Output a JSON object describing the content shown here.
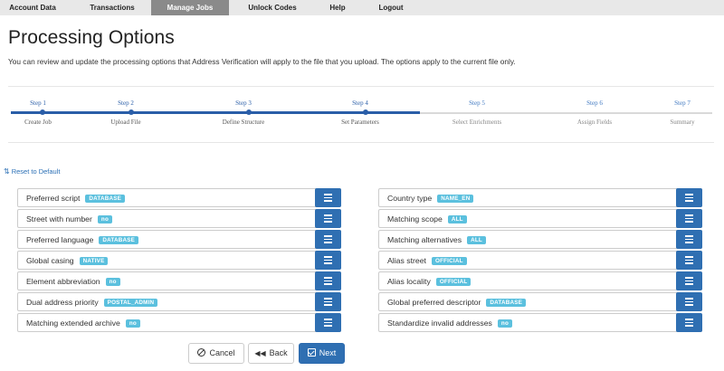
{
  "nav": {
    "items": [
      "Account Data",
      "Transactions",
      "Manage Jobs",
      "Unlock Codes",
      "Help",
      "Logout"
    ],
    "active": "Manage Jobs"
  },
  "page": {
    "title": "Processing Options",
    "description": "You can review and update the processing options that Address Verification will apply to the file that you upload. The options apply to the current file only."
  },
  "stepper": {
    "completed_through": 4,
    "steps": [
      {
        "step": "Step 1",
        "label": "Create Job"
      },
      {
        "step": "Step 2",
        "label": "Upload File"
      },
      {
        "step": "Step 3",
        "label": "Define Structure"
      },
      {
        "step": "Step 4",
        "label": "Set Parameters"
      },
      {
        "step": "Step 5",
        "label": "Select Enrichments"
      },
      {
        "step": "Step 6",
        "label": "Assign Fields"
      },
      {
        "step": "Step 7",
        "label": "Summary"
      }
    ]
  },
  "reset_label": "Reset to Default",
  "options_left": [
    {
      "label": "Preferred script",
      "value": "DATABASE"
    },
    {
      "label": "Street with number",
      "value": "no"
    },
    {
      "label": "Preferred language",
      "value": "DATABASE"
    },
    {
      "label": "Global casing",
      "value": "NATIVE"
    },
    {
      "label": "Element abbreviation",
      "value": "no"
    },
    {
      "label": "Dual address priority",
      "value": "POSTAL_ADMIN"
    },
    {
      "label": "Matching extended archive",
      "value": "no"
    }
  ],
  "options_right": [
    {
      "label": "Country type",
      "value": "NAME_EN"
    },
    {
      "label": "Matching scope",
      "value": "ALL"
    },
    {
      "label": "Matching alternatives",
      "value": "ALL"
    },
    {
      "label": "Alias street",
      "value": "OFFICIAL"
    },
    {
      "label": "Alias locality",
      "value": "OFFICIAL"
    },
    {
      "label": "Global preferred descriptor",
      "value": "DATABASE"
    },
    {
      "label": "Standardize invalid addresses",
      "value": "no"
    }
  ],
  "buttons": {
    "cancel": "Cancel",
    "back": "Back",
    "next": "Next"
  },
  "colors": {
    "primary": "#2f6fb2",
    "badge": "#5bc0de",
    "nav_active": "#8a8a8a"
  }
}
